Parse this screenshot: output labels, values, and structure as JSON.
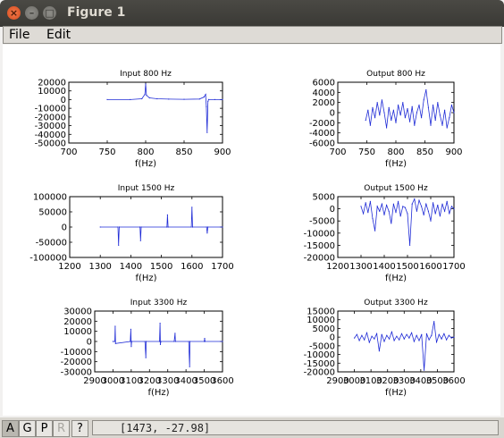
{
  "window": {
    "title": "Figure 1"
  },
  "menu": {
    "file": "File",
    "edit": "Edit"
  },
  "toolbar": {
    "buttons": [
      {
        "label": "A",
        "state": "active"
      },
      {
        "label": "G",
        "state": "normal"
      },
      {
        "label": "P",
        "state": "normal"
      },
      {
        "label": "R",
        "state": "disabled"
      },
      {
        "label": "?",
        "state": "normal"
      }
    ]
  },
  "status": {
    "coordinates": "[1473, -27.98]"
  },
  "colors": {
    "signal": "#1f2bd6",
    "axis": "#000000"
  },
  "chart_data": [
    {
      "type": "line",
      "title": "Input 800 Hz",
      "xlabel": "f(Hz)",
      "ylabel": "",
      "xlim": [
        700,
        900
      ],
      "ylim": [
        -50000,
        20000
      ],
      "xticks": [
        "700",
        "750",
        "800",
        "850",
        "900"
      ],
      "yticks": [
        "20000",
        "10000",
        "0",
        "-10000",
        "-20000",
        "-30000",
        "-40000",
        "-50000"
      ],
      "x": [
        750,
        780,
        795,
        799,
        800,
        801,
        805,
        815,
        830,
        850,
        870,
        876,
        878,
        879,
        880,
        881,
        882,
        890,
        900
      ],
      "y": [
        0,
        0,
        1000,
        6000,
        18000,
        5000,
        2000,
        1000,
        500,
        300,
        600,
        3000,
        6000,
        -8000,
        -38000,
        -2000,
        0,
        0,
        0
      ]
    },
    {
      "type": "line",
      "title": "Output 800 Hz",
      "xlabel": "f(Hz)",
      "ylabel": "",
      "xlim": [
        700,
        900
      ],
      "ylim": [
        -6000,
        6000
      ],
      "xticks": [
        "700",
        "750",
        "800",
        "850",
        "900"
      ],
      "yticks": [
        "6000",
        "4000",
        "2000",
        "0",
        "-2000",
        "-4000",
        "-6000"
      ],
      "x": [
        748,
        752,
        756,
        760,
        764,
        768,
        772,
        776,
        780,
        784,
        788,
        792,
        796,
        800,
        804,
        808,
        812,
        816,
        820,
        824,
        828,
        832,
        836,
        840,
        844,
        848,
        852,
        856,
        860,
        864,
        868,
        872,
        876,
        880,
        884,
        888,
        892,
        896,
        900
      ],
      "y": [
        -1500,
        500,
        -2500,
        1000,
        -1000,
        2000,
        -500,
        2500,
        0,
        -3000,
        1000,
        -1500,
        500,
        -2000,
        1500,
        -500,
        2000,
        -1000,
        800,
        -1800,
        1200,
        -2500,
        0,
        1500,
        -1000,
        2500,
        4500,
        1000,
        -2500,
        1500,
        -1500,
        2000,
        -500,
        -2500,
        500,
        -3000,
        -1000,
        1500,
        0
      ]
    },
    {
      "type": "line",
      "title": "Input 1500 Hz",
      "xlabel": "f(Hz)",
      "ylabel": "",
      "xlim": [
        1200,
        1700
      ],
      "ylim": [
        -100000,
        100000
      ],
      "xticks": [
        "1200",
        "1300",
        "1400",
        "1500",
        "1600",
        "1700"
      ],
      "yticks": [
        "100000",
        "50000",
        "0",
        "-50000",
        "-100000"
      ],
      "x": [
        1300,
        1358,
        1360,
        1362,
        1430,
        1432,
        1434,
        1518,
        1520,
        1522,
        1598,
        1600,
        1602,
        1648,
        1650,
        1652,
        1700
      ],
      "y": [
        0,
        0,
        -60000,
        0,
        0,
        -45000,
        0,
        0,
        40000,
        0,
        0,
        65000,
        0,
        0,
        -20000,
        0,
        0
      ]
    },
    {
      "type": "line",
      "title": "Output 1500 Hz",
      "xlabel": "f(Hz)",
      "ylabel": "",
      "xlim": [
        1200,
        1700
      ],
      "ylim": [
        -20000,
        5000
      ],
      "xticks": [
        "1200",
        "1300",
        "1400",
        "1500",
        "1600",
        "1700"
      ],
      "yticks": [
        "5000",
        "0",
        "-5000",
        "-10000",
        "-15000",
        "-20000"
      ],
      "x": [
        1300,
        1310,
        1320,
        1330,
        1340,
        1350,
        1360,
        1370,
        1380,
        1390,
        1400,
        1410,
        1420,
        1430,
        1440,
        1450,
        1460,
        1470,
        1480,
        1490,
        1500,
        1510,
        1520,
        1530,
        1540,
        1550,
        1560,
        1570,
        1580,
        1590,
        1600,
        1610,
        1620,
        1630,
        1640,
        1650,
        1660,
        1670,
        1680,
        1690,
        1700
      ],
      "y": [
        1000,
        -2000,
        2500,
        -1500,
        3000,
        -4000,
        -9000,
        1000,
        -1000,
        2000,
        -2500,
        1500,
        -1000,
        -6000,
        2000,
        -1500,
        3000,
        -3000,
        1000,
        500,
        -2000,
        -15000,
        2000,
        4000,
        -1000,
        3500,
        1000,
        -2500,
        2000,
        -1000,
        -5000,
        2500,
        -2000,
        1500,
        -3000,
        2000,
        -1000,
        3000,
        -2000,
        1000,
        0
      ]
    },
    {
      "type": "line",
      "title": "Input 3300 Hz",
      "xlabel": "f(Hz)",
      "ylabel": "",
      "xlim": [
        2900,
        3600
      ],
      "ylim": [
        -30000,
        30000
      ],
      "xticks": [
        "2900",
        "3000",
        "3100",
        "3200",
        "3300",
        "3400",
        "3500",
        "3600"
      ],
      "yticks": [
        "30000",
        "20000",
        "10000",
        "0",
        "-10000",
        "-20000",
        "-30000"
      ],
      "x": [
        3000,
        3010,
        3012,
        3014,
        3095,
        3098,
        3100,
        3102,
        3175,
        3180,
        3182,
        3255,
        3258,
        3260,
        3262,
        3335,
        3340,
        3342,
        3415,
        3420,
        3422,
        3500,
        3502,
        3504,
        3600
      ],
      "y": [
        0,
        0,
        15000,
        -2000,
        0,
        12000,
        -5000,
        0,
        0,
        -16000,
        0,
        0,
        18000,
        -3000,
        0,
        0,
        8000,
        0,
        0,
        -25000,
        0,
        0,
        3000,
        0,
        0
      ]
    },
    {
      "type": "line",
      "title": "Output 3300 Hz",
      "xlabel": "f(Hz)",
      "ylabel": "",
      "xlim": [
        2900,
        3600
      ],
      "ylim": [
        -20000,
        15000
      ],
      "xticks": [
        "2900",
        "3000",
        "3100",
        "3200",
        "3300",
        "3400",
        "3500",
        "3600"
      ],
      "yticks": [
        "15000",
        "10000",
        "5000",
        "0",
        "-5000",
        "-10000",
        "-15000",
        "-20000"
      ],
      "x": [
        3000,
        3015,
        3030,
        3045,
        3060,
        3075,
        3090,
        3105,
        3120,
        3135,
        3150,
        3165,
        3180,
        3195,
        3210,
        3225,
        3240,
        3255,
        3270,
        3285,
        3300,
        3315,
        3330,
        3345,
        3360,
        3375,
        3390,
        3405,
        3420,
        3435,
        3450,
        3465,
        3480,
        3495,
        3510,
        3525,
        3540,
        3555,
        3570,
        3585,
        3600
      ],
      "y": [
        -500,
        1500,
        -2000,
        1000,
        -1500,
        2500,
        -3000,
        500,
        -1000,
        2000,
        -8000,
        1500,
        -2500,
        1000,
        -1000,
        3000,
        -2000,
        500,
        -1500,
        2000,
        -1000,
        1500,
        -500,
        2500,
        -2500,
        1000,
        -2000,
        1500,
        -19000,
        2000,
        -1500,
        1000,
        9000,
        -3000,
        1500,
        -1000,
        2000,
        -1500,
        1000,
        -500,
        0
      ]
    }
  ]
}
